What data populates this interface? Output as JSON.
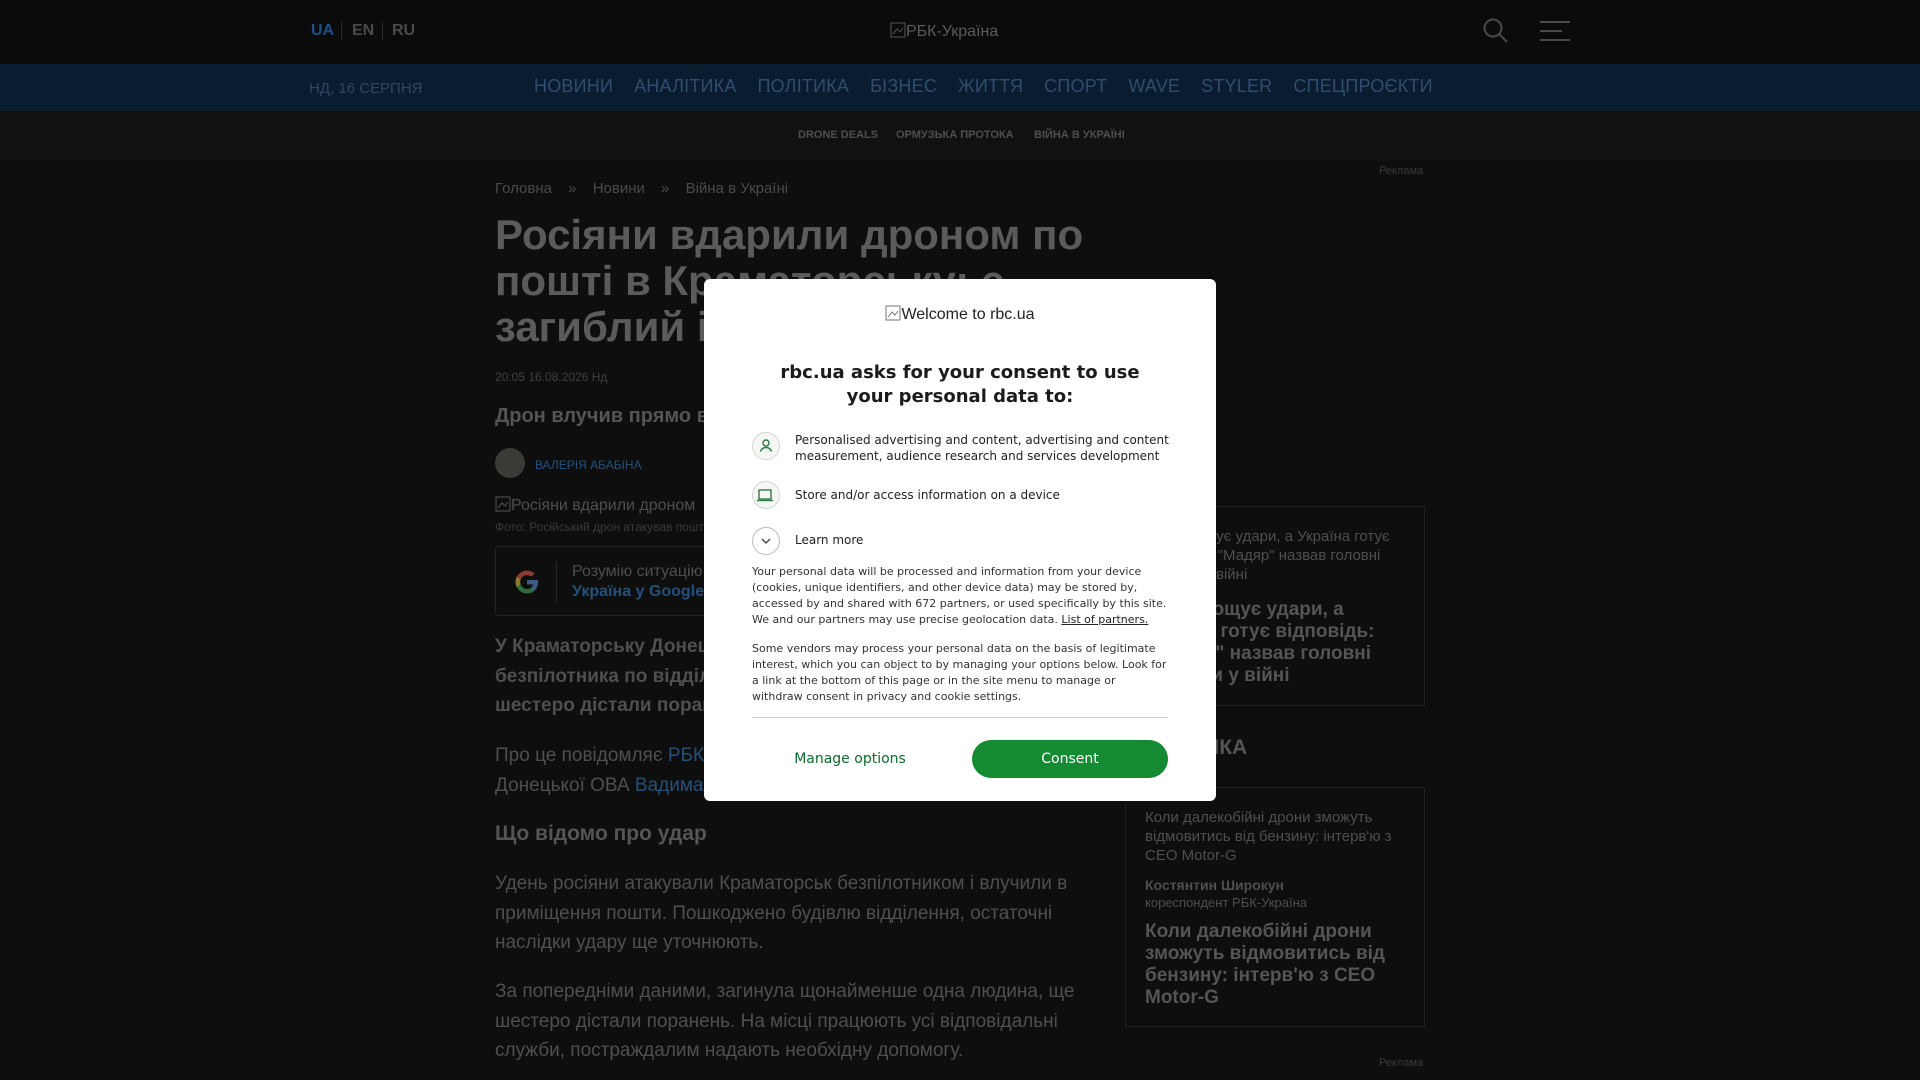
{
  "header": {
    "languages": [
      "UA",
      "EN",
      "RU"
    ],
    "logo_text": "РБК-Україна",
    "search_icon": "search-icon",
    "menu_icon": "hamburger-menu-icon"
  },
  "nav": {
    "date": "НД, 16 СЕРПНЯ",
    "links": [
      "НОВИНИ",
      "АНАЛІТИКА",
      "ПОЛІТИКА",
      "БІЗНЕС",
      "ЖИТТЯ",
      "СПОРТ",
      "WAVE",
      "STYLER",
      "СПЕЦПРОЄКТИ"
    ]
  },
  "subnav": {
    "links": [
      "DRONE DEALS",
      "ОРМУЗЬКА ПРОТОКА",
      "ВІЙНА В УКРАЇНІ"
    ]
  },
  "ads": {
    "label": "Реклама"
  },
  "article": {
    "breadcrumb": [
      "Головна",
      "»",
      "Новини",
      "»",
      "Війна в Україні"
    ],
    "title": "Росіяни вдарили дроном по пошті в Краматорську: є загиблий і поранені",
    "datetime": "20:05 16.08.2026 Нд",
    "lead": "Дрон влучив прямо в приміщення відділення",
    "author": "ВАЛЕРІЯ АБАБІНА",
    "photo_alt": "Росіяни вдарили дроном",
    "photo_caption": "Фото: Російський дрон атакував пошту",
    "google_box": {
      "line1": "Розумію ситуацію",
      "line2": "Україна у Google"
    },
    "para1": "У Краматорську Донецької області внаслідок удару безпілотника по відділенню пошти загинула людина, ще шестеро дістали поранення.",
    "para2_prefix": "Про це повідомляє",
    "para2_link1": "РБК-Україна",
    "para2_mid": "з посиланням на начальника Донецької ОВА",
    "para2_link2": "Вадима Філашкіна",
    "subhead": "Що відомо про удар",
    "para3": "Удень росіяни атакували Краматорськ безпілотником і влучили в приміщення пошти. Пошкоджено будівлю відділення, остаточні наслідки удару ще уточнюють.",
    "para4": "За попередніми даними, загинула щонайменше одна людина, ще шестеро дістали поранень. На місці працюють усі відповідальні служби, постраждалим надають необхідну допомогу."
  },
  "sidebar": {
    "card1_img_alt": "РФ нарощує удари, а Україна готує відповідь: \"Мадяр\" назвав головні виклики у війні",
    "card1_title": "РФ нарощує удари, а Україна готує відповідь: \"Мадяр\" назвав головні виклики у війні",
    "section_label": "АНАЛІТИКА",
    "card2_img_alt": "Коли далекобійні дрони зможуть відмовитись від бензину: інтерв'ю з CEO Motor-G",
    "card2_author": "Костянтин Широкун",
    "card2_role": "кореспондент РБК-Україна",
    "card2_title": "Коли далекобійні дрони зможуть відмовитись від бензину: інтерв'ю з CEO Motor-G"
  },
  "consent": {
    "logo_alt": "Welcome to rbc.ua",
    "heading": "rbc.ua asks for your consent to use your personal data to:",
    "purpose1": "Personalised advertising and content, advertising and content measurement, audience research and services development",
    "purpose2": "Store and/or access information on a device",
    "learn_more": "Learn more",
    "para1": "Your personal data will be processed and information from your device (cookies, unique identifiers, and other device data) may be stored by, accessed by and shared with 672 partners, or used specifically by this site. We and our partners may use precise geolocation data.",
    "partners_link": "List of partners.",
    "para2": "Some vendors may process your personal data on the basis of legitimate interest, which you can object to by managing your options below. Look for a link at the bottom of this page or in the site menu to manage or withdraw consent in privacy and cookie settings.",
    "manage_label": "Manage options",
    "consent_label": "Consent"
  },
  "colors": {
    "consent_green": "#148a32",
    "link_blue": "#24507c",
    "nav_bg": "#0a1c30"
  }
}
